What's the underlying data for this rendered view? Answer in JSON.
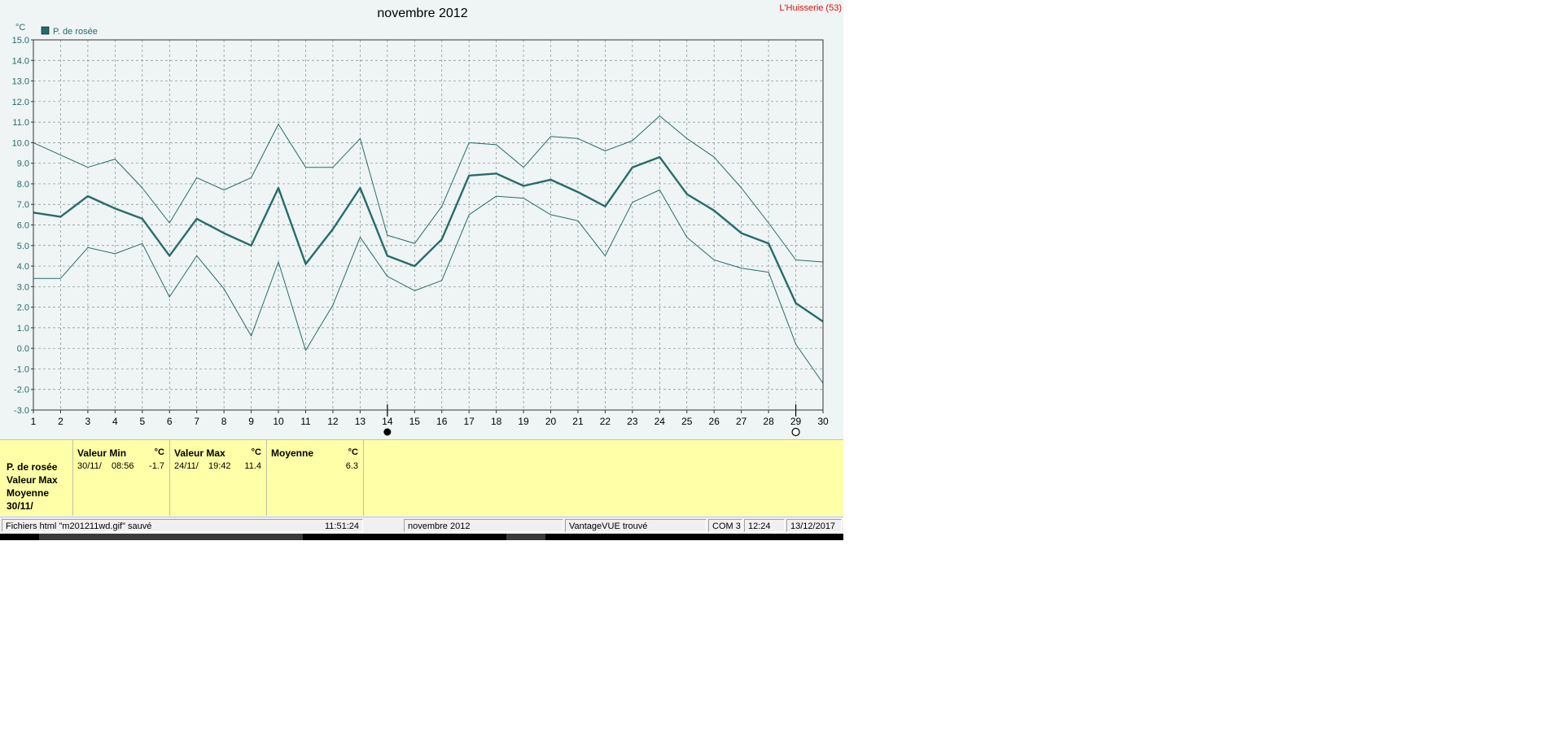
{
  "station_label": "L'Huisserie (53)",
  "colors": {
    "series": "#2a6a6a",
    "grid": "#7f8f8f",
    "background": "#eef5f4",
    "panel": "#ffffa8",
    "station": "#e01010"
  },
  "chart_data": {
    "type": "line",
    "title": "novembre 2012",
    "ylabel": "°C",
    "xlabel": "",
    "legend": "P. de rosée",
    "ylim": [
      -3,
      15
    ],
    "ytick_labels": [
      "15.0",
      "14.0",
      "13.0",
      "12.0",
      "11.0",
      "10.0",
      "9.0",
      "8.0",
      "7.0",
      "6.0",
      "5.0",
      "4.0",
      "3.0",
      "2.0",
      "1.0",
      "0.0",
      "-1.0",
      "-2.0",
      "-3.0"
    ],
    "x": [
      1,
      2,
      3,
      4,
      5,
      6,
      7,
      8,
      9,
      10,
      11,
      12,
      13,
      14,
      15,
      16,
      17,
      18,
      19,
      20,
      21,
      22,
      23,
      24,
      25,
      26,
      27,
      28,
      29,
      30
    ],
    "grid": true,
    "moon_markers": [
      {
        "day": 14,
        "phase": "new-moon-icon"
      },
      {
        "day": 29,
        "phase": "full-moon-icon"
      }
    ],
    "series": [
      {
        "name": "P. de rosée",
        "role": "max",
        "values": [
          10.0,
          9.4,
          8.8,
          9.2,
          7.8,
          6.1,
          8.3,
          7.7,
          8.3,
          10.9,
          8.8,
          8.8,
          10.2,
          5.5,
          5.1,
          6.9,
          10.0,
          9.9,
          8.8,
          10.3,
          10.2,
          9.6,
          10.1,
          11.3,
          10.2,
          9.3,
          7.8,
          6.1,
          4.3,
          4.2
        ]
      },
      {
        "name": "P. de rosée",
        "role": "moyenne",
        "values": [
          6.6,
          6.4,
          7.4,
          6.8,
          6.3,
          4.5,
          6.3,
          5.6,
          5.0,
          7.8,
          4.1,
          5.8,
          7.8,
          4.5,
          4.0,
          5.3,
          8.4,
          8.5,
          7.9,
          8.2,
          7.6,
          6.9,
          8.8,
          9.3,
          7.5,
          6.7,
          5.6,
          5.1,
          2.2,
          1.3
        ]
      },
      {
        "name": "P. de rosée",
        "role": "min",
        "values": [
          3.4,
          3.4,
          4.9,
          4.6,
          5.1,
          2.5,
          4.5,
          2.9,
          0.6,
          4.2,
          -0.1,
          2.1,
          5.4,
          3.5,
          2.8,
          3.3,
          6.5,
          7.4,
          7.3,
          6.5,
          6.2,
          4.5,
          7.1,
          7.7,
          5.4,
          4.3,
          3.9,
          3.7,
          0.2,
          -1.7
        ]
      }
    ]
  },
  "info": {
    "labels": {
      "parameter": "P. de rosée",
      "max": "Valeur Max",
      "avg": "Moyenne",
      "date": "30/11/"
    },
    "min": {
      "header": "Valeur Min",
      "unit": "°C",
      "date": "30/11/",
      "time": "08:56",
      "value": "-1.7"
    },
    "max": {
      "header": "Valeur Max",
      "unit": "°C",
      "date": "24/11/",
      "time": "19:42",
      "value": "11.4"
    },
    "avg": {
      "header": "Moyenne",
      "unit": "°C",
      "value": "6.3"
    }
  },
  "status": {
    "file_msg": "Fichiers html  \"m201211wd.gif\"  sauvé",
    "time1": "11:51:24",
    "month": "novembre 2012",
    "device": "VantageVUE trouvé",
    "port": "COM 3",
    "time2": "12:24",
    "date": "13/12/2017"
  }
}
